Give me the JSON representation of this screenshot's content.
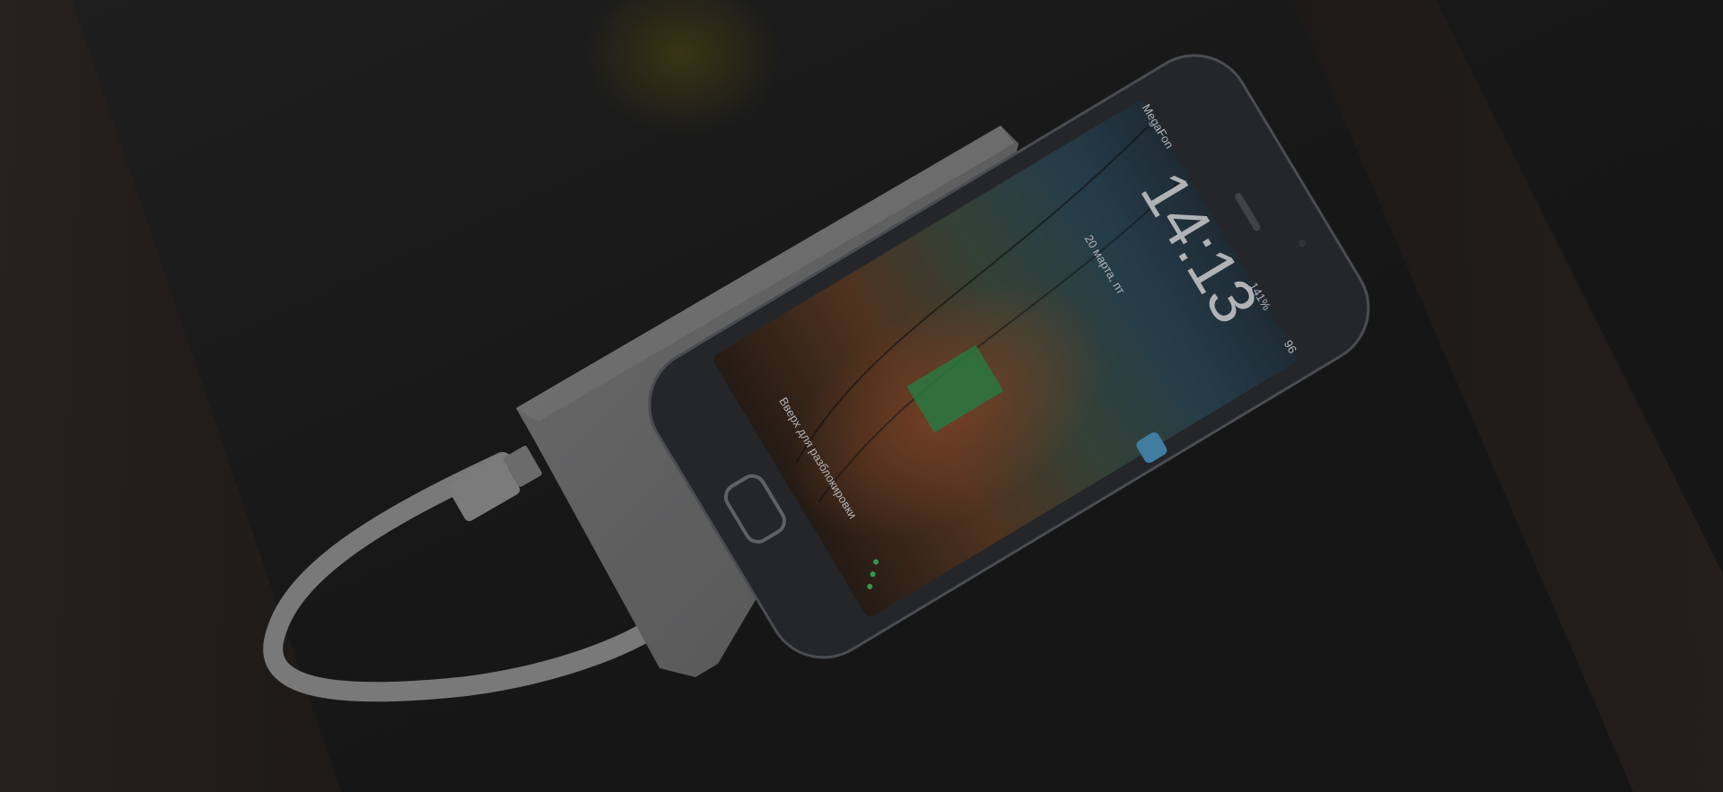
{
  "photo": {
    "description_tag": "phone-charging-from-power-bank",
    "colors": {
      "background": "#1b1b1b",
      "wood": "#2b231f",
      "powerbank": "#6f6f70",
      "cable": "#8a8a8b",
      "phone_body": "#2a2c30",
      "battery_indicator": "#2f8a4a"
    }
  },
  "lockscreen": {
    "carrier": "MegaFon",
    "time": "14:13",
    "date": "20 марта, пт",
    "speed": "141%",
    "battery": "96",
    "unlock_hint": "Вверх для разблокировки"
  }
}
